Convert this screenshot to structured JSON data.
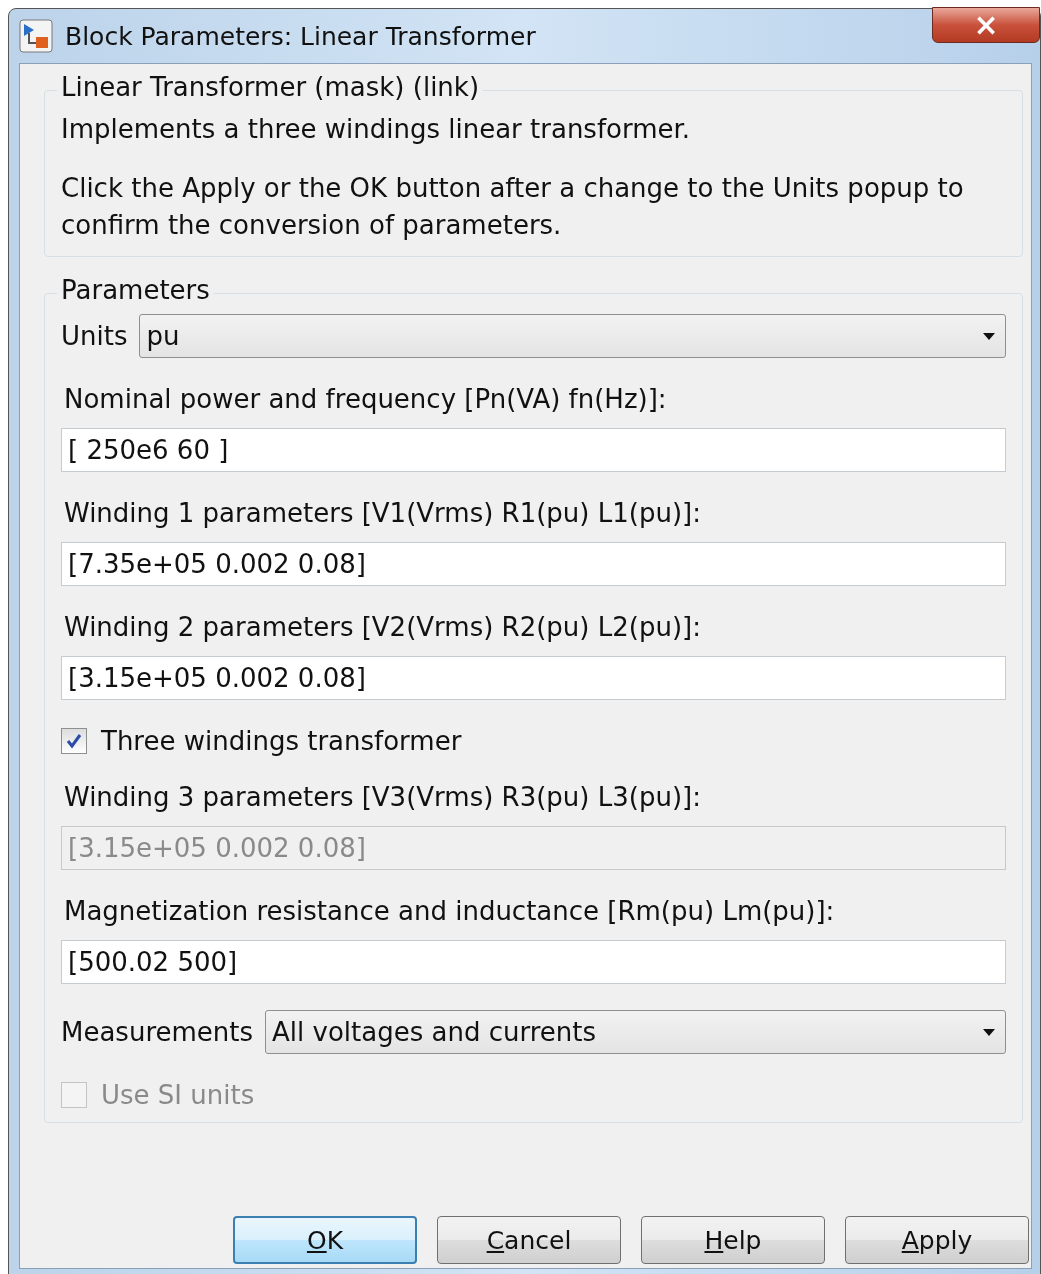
{
  "window": {
    "title": "Block Parameters: Linear Transformer",
    "close": "×"
  },
  "description": {
    "title": "Linear Transformer (mask) (link)",
    "paragraphs": [
      "Implements a three windings linear transformer.",
      "Click the Apply or the OK button after a change to the Units popup to confirm the conversion of parameters."
    ]
  },
  "parameters": {
    "title": "Parameters",
    "items": [
      {
        "kind": "dropdown",
        "label": "Units",
        "value": "pu"
      },
      {
        "kind": "field",
        "label": "Nominal power and frequency [Pn(VA) fn(Hz)]:",
        "value": "[ 250e6 60 ]",
        "disabled": false
      },
      {
        "kind": "field",
        "label": "Winding 1 parameters [V1(Vrms) R1(pu) L1(pu)]:",
        "value": "[7.35e+05 0.002 0.08]",
        "disabled": false
      },
      {
        "kind": "field",
        "label": "Winding 2 parameters [V2(Vrms) R2(pu) L2(pu)]:",
        "value": "[3.15e+05 0.002 0.08]",
        "disabled": false
      },
      {
        "kind": "checkbox",
        "label": "Three windings transformer",
        "checked": true,
        "disabled": false
      },
      {
        "kind": "field",
        "label": "Winding 3 parameters [V3(Vrms) R3(pu) L3(pu)]:",
        "value": "[3.15e+05 0.002 0.08]",
        "disabled": true
      },
      {
        "kind": "field",
        "label": "Magnetization resistance and inductance [Rm(pu) Lm(pu)]:",
        "value": "[500.02 500]",
        "disabled": false
      },
      {
        "kind": "dropdown",
        "label": "Measurements",
        "value": "All voltages and currents"
      },
      {
        "kind": "checkbox",
        "label": "Use SI units",
        "checked": false,
        "disabled": true
      }
    ]
  },
  "buttons": [
    {
      "mnemonic": "O",
      "rest": "K",
      "default": true
    },
    {
      "mnemonic": "C",
      "rest": "ancel",
      "default": false
    },
    {
      "mnemonic": "H",
      "rest": "elp",
      "default": false
    },
    {
      "mnemonic": "A",
      "rest": "pply",
      "default": false
    }
  ]
}
